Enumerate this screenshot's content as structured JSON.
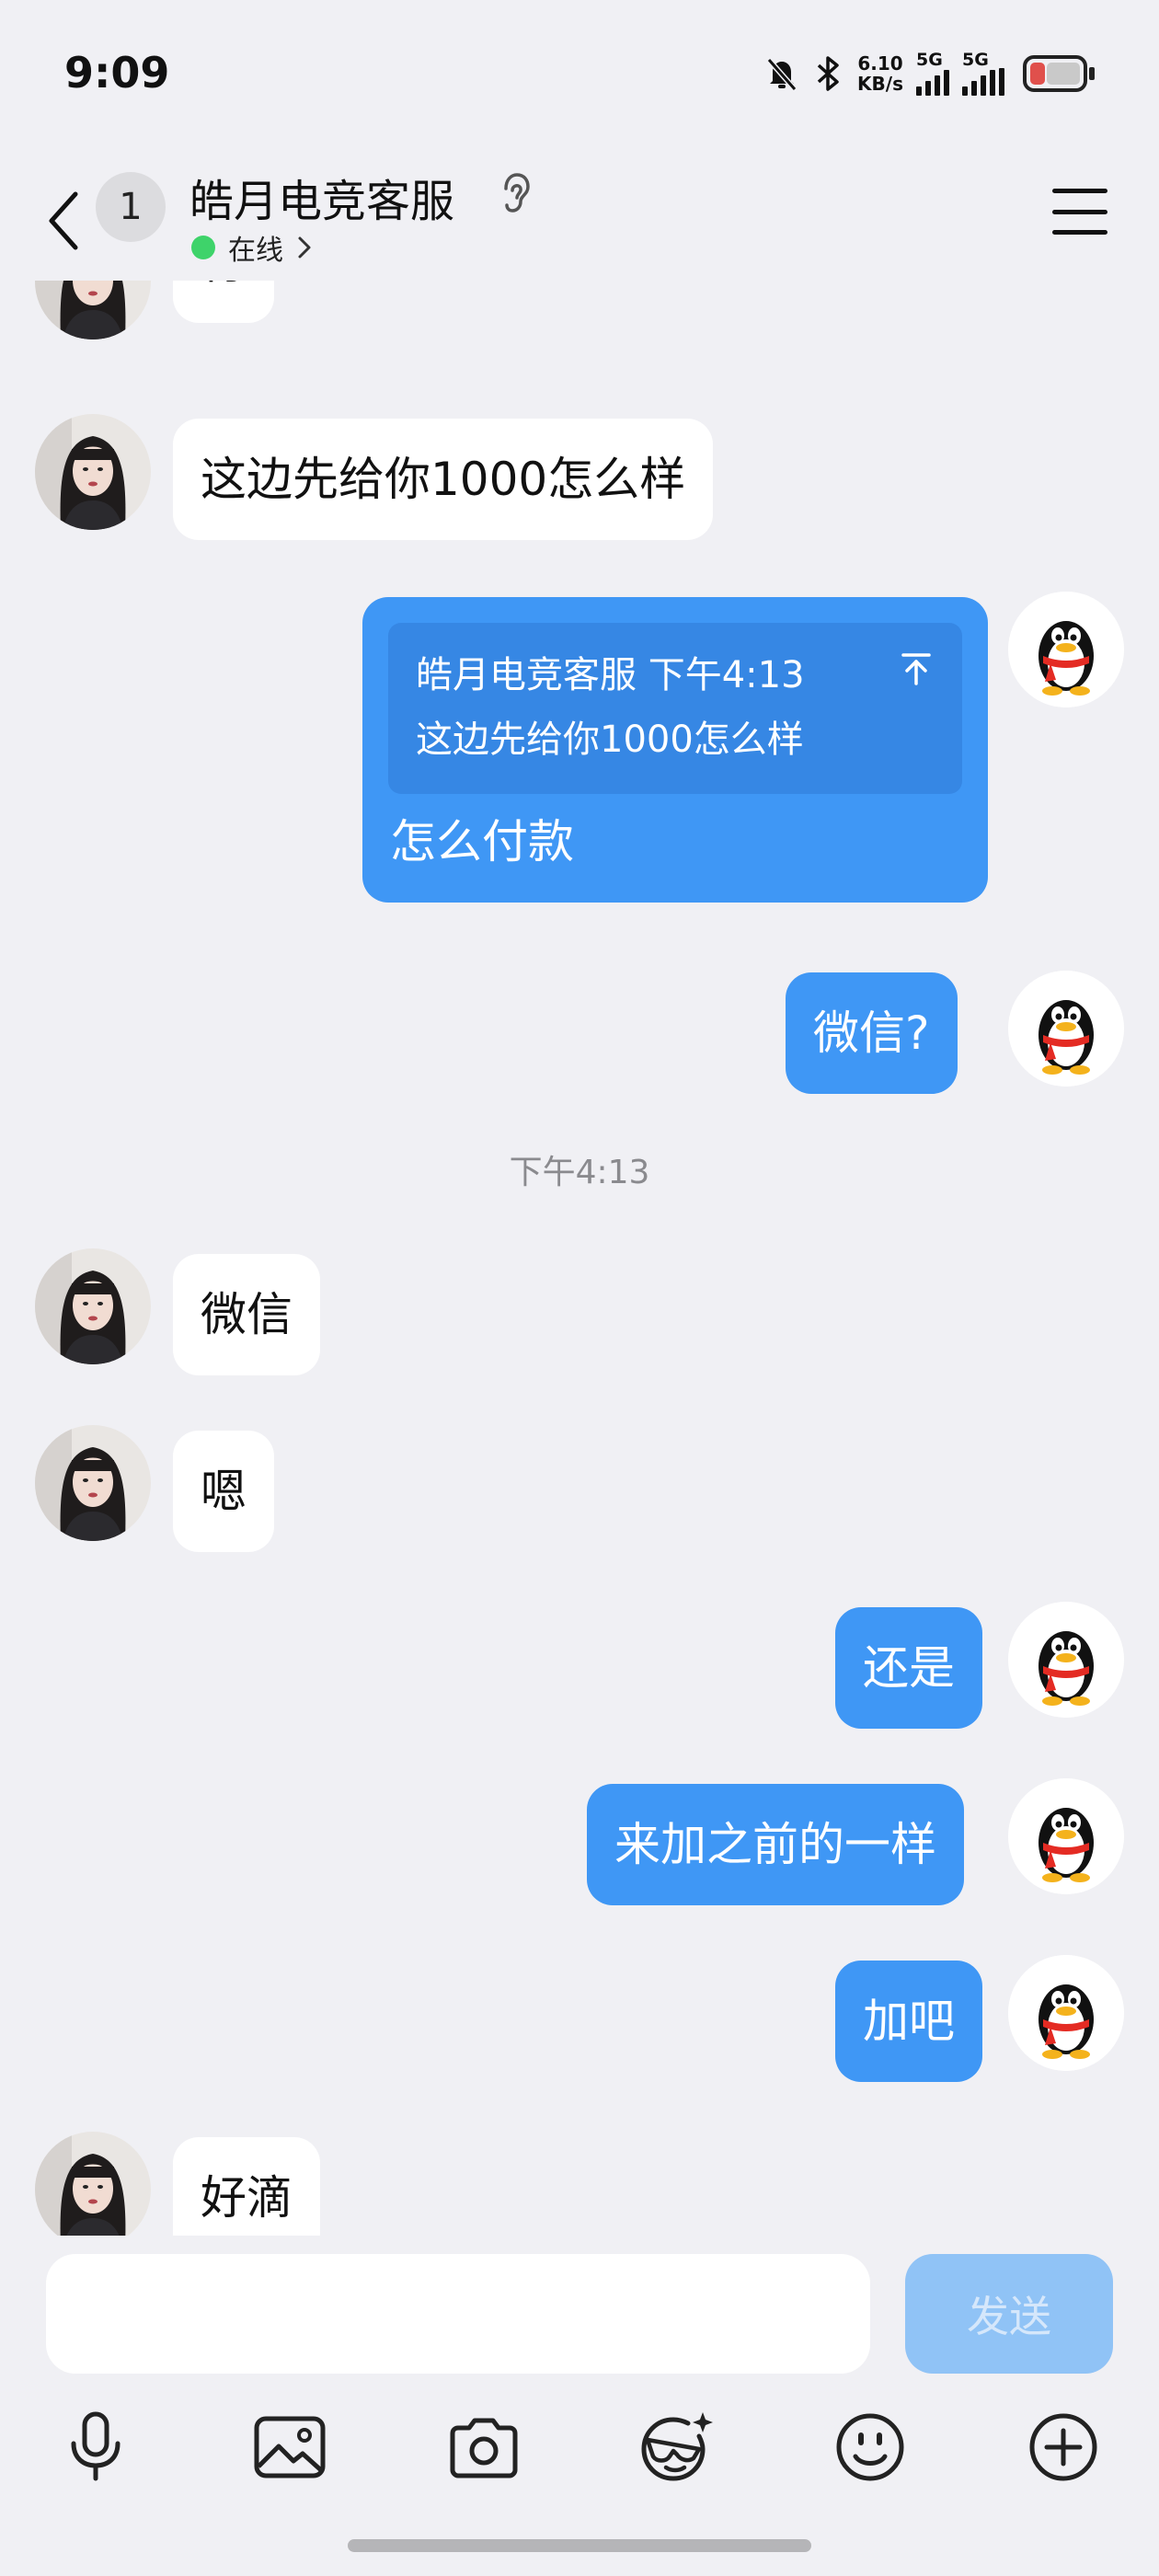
{
  "status_bar": {
    "time": "9:09",
    "net_speed_value": "6.10",
    "net_speed_unit": "KB/s",
    "sim1_label": "5G",
    "sim2_label": "5G",
    "battery_color": "#e0504c"
  },
  "header": {
    "unread_count": "1",
    "title": "皓月电竞客服",
    "status": "在线",
    "online_color": "#3ed36a"
  },
  "messages": {
    "m1": "行",
    "m2": "这边先给你1000怎么样",
    "m3_quote_header": "皓月电竞客服 下午4:13",
    "m3_quote_text": "这边先给你1000怎么样",
    "m3_reply": "怎么付款",
    "m4": "微信?",
    "timestamp": "下午4:13",
    "m5": "微信",
    "m6": "嗯",
    "m7": "还是",
    "m8": "来加之前的一样",
    "m9": "加吧",
    "m10": "好滴"
  },
  "colors": {
    "outgoing_bubble": "#3f97f5",
    "incoming_bubble": "#ffffff",
    "background": "#f0f0f4"
  },
  "input": {
    "value": "",
    "send_label": "发送"
  },
  "toolbar_icons": [
    "microphone-icon",
    "image-icon",
    "camera-icon",
    "sticker-icon",
    "emoji-icon",
    "plus-icon"
  ]
}
